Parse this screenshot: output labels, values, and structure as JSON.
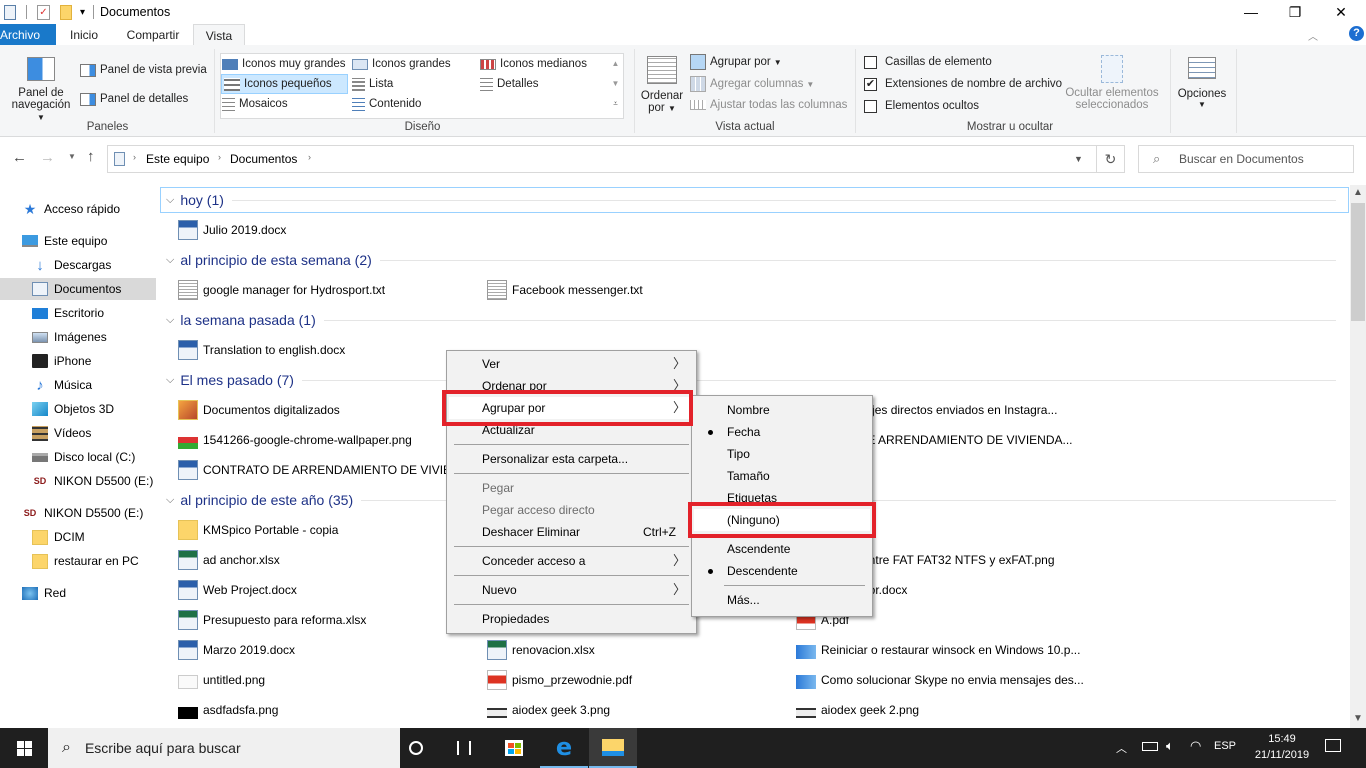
{
  "window": {
    "title": "Documentos",
    "controls": {
      "minimize": "—",
      "maximize": "❐",
      "close": "✕"
    }
  },
  "ribbon_tabs": [
    {
      "label": "Archivo"
    },
    {
      "label": "Inicio"
    },
    {
      "label": "Compartir"
    },
    {
      "label": "Vista"
    }
  ],
  "ribbon": {
    "panes": {
      "nav_pane_label_1": "Panel de",
      "nav_pane_label_2": "navegación",
      "preview_pane": "Panel de vista previa",
      "details_pane": "Panel de detalles",
      "group_label": "Paneles"
    },
    "layout": {
      "items": [
        {
          "label": "Iconos muy grandes"
        },
        {
          "label": "Iconos grandes"
        },
        {
          "label": "Iconos medianos"
        },
        {
          "label": "Iconos pequeños",
          "selected": true
        },
        {
          "label": "Lista"
        },
        {
          "label": "Detalles"
        },
        {
          "label": "Mosaicos"
        },
        {
          "label": "Contenido"
        }
      ],
      "group_label": "Diseño"
    },
    "current_view": {
      "sort_by_1": "Ordenar",
      "sort_by_2": "por",
      "group_by": "Agrupar por",
      "add_columns": "Agregar columnas",
      "fit_columns": "Ajustar todas las columnas",
      "group_label": "Vista actual"
    },
    "show_hide": {
      "item_checkboxes": {
        "label": "Casillas de elemento",
        "checked": false
      },
      "file_extensions": {
        "label": "Extensiones de nombre de archivo",
        "checked": true
      },
      "hidden_items": {
        "label": "Elementos ocultos",
        "checked": false
      },
      "hide_selected_1": "Ocultar elementos",
      "hide_selected_2": "seleccionados",
      "group_label": "Mostrar u ocultar"
    },
    "options": "Opciones"
  },
  "address": {
    "breadcrumb": [
      "Este equipo",
      "Documentos"
    ],
    "search_placeholder": "Buscar en Documentos"
  },
  "sidebar": {
    "items": [
      {
        "label": "Acceso rápido",
        "icon": "star-icon"
      },
      {
        "label": "Este equipo",
        "icon": "computer-icon"
      },
      {
        "label": "Descargas",
        "icon": "download-icon"
      },
      {
        "label": "Documentos",
        "icon": "document-icon",
        "selected": true
      },
      {
        "label": "Escritorio",
        "icon": "desktop-icon"
      },
      {
        "label": "Imágenes",
        "icon": "images-icon"
      },
      {
        "label": "iPhone",
        "icon": "phone-icon"
      },
      {
        "label": "Música",
        "icon": "music-icon"
      },
      {
        "label": "Objetos 3D",
        "icon": "cube-icon"
      },
      {
        "label": "Vídeos",
        "icon": "video-icon"
      },
      {
        "label": "Disco local (C:)",
        "icon": "drive-icon"
      },
      {
        "label": "NIKON D5500 (E:)",
        "icon": "sd-card-icon"
      },
      {
        "label": "NIKON D5500 (E:)",
        "icon": "sd-card-icon"
      },
      {
        "label": "DCIM",
        "icon": "folder-icon"
      },
      {
        "label": "restaurar en PC",
        "icon": "folder-icon"
      },
      {
        "label": "Red",
        "icon": "network-icon"
      }
    ]
  },
  "groups": [
    {
      "label": "hoy (1)",
      "files": [
        {
          "name": "Julio 2019.docx",
          "type": "docx"
        }
      ]
    },
    {
      "label": "al principio de esta semana (2)",
      "files": [
        {
          "name": "google manager for Hydrosport.txt",
          "type": "txt"
        },
        {
          "name": "Facebook messenger.txt",
          "type": "txt"
        }
      ]
    },
    {
      "label": "la semana pasada (1)",
      "files": [
        {
          "name": "Translation to english.docx",
          "type": "docx"
        }
      ]
    },
    {
      "label": "El mes pasado (7)",
      "files": [
        {
          "name": "Documentos digitalizados",
          "type": "folder-img"
        },
        {
          "name": "1541266-google-chrome-wallpaper.png",
          "type": "png-chrome"
        },
        {
          "name": "CONTRATO DE ARRENDAMIENTO DE VIVIENDA",
          "type": "docx"
        },
        {
          "name": "ensajes directos enviados en Instagra...",
          "type": "hidden"
        },
        {
          "name": "O DE ARRENDAMIENTO DE VIVIENDA...",
          "type": "hidden"
        }
      ]
    },
    {
      "label": "al principio de este año (35)",
      "files": [
        {
          "name": "KMSpico Portable - copia",
          "type": "folder-doc"
        },
        {
          "name": "ad anchor.xlsx",
          "type": "xlsx"
        },
        {
          "name": "Web Project.docx",
          "type": "docx"
        },
        {
          "name": "Presupuesto para reforma.xlsx",
          "type": "xlsx"
        },
        {
          "name": "Marzo 2019.docx",
          "type": "docx"
        },
        {
          "name": "untitled.png",
          "type": "png"
        },
        {
          "name": "asdfadsfa.png",
          "type": "png-black"
        },
        {
          "name": "renovacion.xlsx",
          "type": "xlsx"
        },
        {
          "name": "pismo_przewodnie.pdf",
          "type": "pdf"
        },
        {
          "name": "aiodex geek 3.png",
          "type": "png-strip"
        },
        {
          "name": "as entre FAT FAT32 NTFS y exFAT.png",
          "type": "hidden"
        },
        {
          "name": "ect for.docx",
          "type": "hidden"
        },
        {
          "name": "A.pdf",
          "type": "pdf"
        },
        {
          "name": "Reiniciar o restaurar winsock en Windows 10.p...",
          "type": "png-blue"
        },
        {
          "name": "Como solucionar Skype no envia mensajes des...",
          "type": "png-blue"
        },
        {
          "name": "aiodex geek 2.png",
          "type": "png-strip"
        }
      ]
    }
  ],
  "context_menu": {
    "items": [
      {
        "label": "Ver",
        "submenu": true
      },
      {
        "label": "Ordenar por",
        "submenu": true
      },
      {
        "label": "Agrupar por",
        "submenu": true,
        "highlighted": true
      },
      {
        "label": "Actualizar"
      },
      {
        "label": "Personalizar esta carpeta..."
      },
      {
        "label": "Pegar",
        "disabled": true
      },
      {
        "label": "Pegar acceso directo",
        "disabled": true
      },
      {
        "label": "Deshacer Eliminar",
        "shortcut": "Ctrl+Z"
      },
      {
        "label": "Conceder acceso a",
        "submenu": true
      },
      {
        "label": "Nuevo",
        "submenu": true
      },
      {
        "label": "Propiedades"
      }
    ]
  },
  "submenu": {
    "items": [
      {
        "label": "Nombre"
      },
      {
        "label": "Fecha",
        "checked": true
      },
      {
        "label": "Tipo"
      },
      {
        "label": "Tamaño"
      },
      {
        "label": "Etiquetas"
      },
      {
        "label": "(Ninguno)",
        "highlighted": true
      },
      {
        "label": "Ascendente"
      },
      {
        "label": "Descendente",
        "checked": true
      },
      {
        "label": "Más..."
      }
    ]
  },
  "highlight_color": "#e3222a",
  "taskbar": {
    "search_placeholder": "Escribe aquí para buscar",
    "language": "ESP",
    "time": "15:49",
    "date": "21/11/2019"
  }
}
